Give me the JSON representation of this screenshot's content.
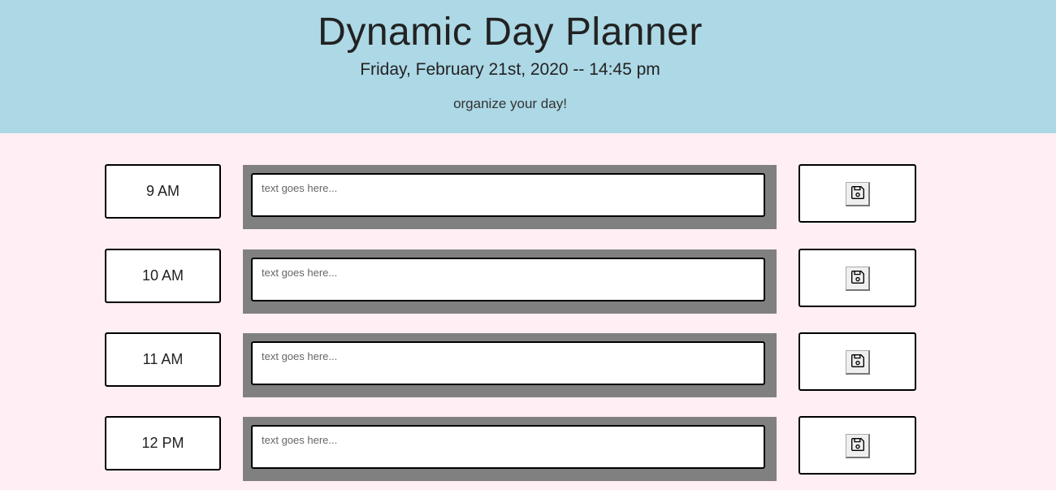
{
  "header": {
    "title": "Dynamic Day Planner",
    "date": "Friday, February 21st, 2020 -- 14:45 pm",
    "lead": "organize your day!"
  },
  "planner": {
    "placeholder": "text goes here...",
    "rows": [
      {
        "hour": "9 AM",
        "save_icon": "floppy-disk-icon"
      },
      {
        "hour": "10 AM",
        "save_icon": "floppy-disk-icon"
      },
      {
        "hour": "11 AM",
        "save_icon": "floppy-disk-icon"
      },
      {
        "hour": "12 PM",
        "save_icon": "floppy-disk-icon"
      }
    ]
  },
  "colors": {
    "header_bg": "#add8e6",
    "page_bg": "#ffeef4",
    "past_block": "#808080"
  }
}
